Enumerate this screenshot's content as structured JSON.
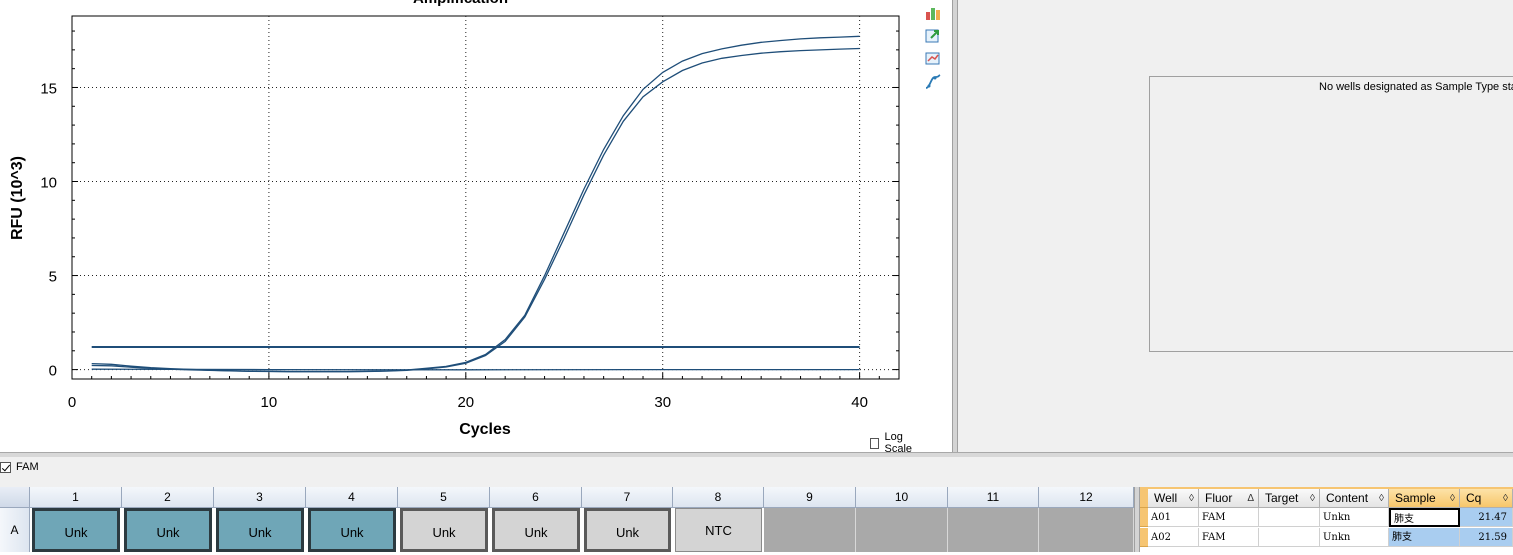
{
  "chart_data": {
    "type": "line",
    "title": "Amplification",
    "xlabel": "Cycles",
    "ylabel": "RFU (10^3)",
    "xlim": [
      0,
      42
    ],
    "ylim": [
      -0.5,
      18.8
    ],
    "xticks": [
      0,
      10,
      20,
      30,
      40
    ],
    "yticks": [
      0,
      5,
      10,
      15
    ],
    "grid": "dotted",
    "threshold": 1.2,
    "series": [
      {
        "well": "A01",
        "color": "#1f4e79",
        "x": [
          1,
          2,
          3,
          4,
          5,
          6,
          7,
          8,
          9,
          10,
          11,
          12,
          13,
          14,
          15,
          16,
          17,
          18,
          19,
          20,
          21,
          22,
          23,
          24,
          25,
          26,
          27,
          28,
          29,
          30,
          31,
          32,
          33,
          34,
          35,
          36,
          37,
          38,
          39,
          40
        ],
        "y": [
          0.32,
          0.28,
          0.18,
          0.1,
          0.05,
          0.01,
          -0.03,
          -0.06,
          -0.08,
          -0.09,
          -0.1,
          -0.1,
          -0.1,
          -0.1,
          -0.09,
          -0.07,
          -0.02,
          0.07,
          0.17,
          0.38,
          0.8,
          1.6,
          2.9,
          5.0,
          7.3,
          9.6,
          11.7,
          13.5,
          14.9,
          15.8,
          16.4,
          16.8,
          17.05,
          17.25,
          17.4,
          17.5,
          17.58,
          17.64,
          17.68,
          17.72
        ]
      },
      {
        "well": "A02",
        "color": "#1f4e79",
        "x": [
          1,
          2,
          3,
          4,
          5,
          6,
          7,
          8,
          9,
          10,
          11,
          12,
          13,
          14,
          15,
          16,
          17,
          18,
          19,
          20,
          21,
          22,
          23,
          24,
          25,
          26,
          27,
          28,
          29,
          30,
          31,
          32,
          33,
          34,
          35,
          36,
          37,
          38,
          39,
          40
        ],
        "y": [
          0.22,
          0.2,
          0.13,
          0.07,
          0.02,
          -0.01,
          -0.04,
          -0.07,
          -0.09,
          -0.1,
          -0.11,
          -0.11,
          -0.11,
          -0.11,
          -0.1,
          -0.08,
          -0.04,
          0.04,
          0.14,
          0.34,
          0.75,
          1.5,
          2.8,
          4.8,
          7.0,
          9.3,
          11.4,
          13.2,
          14.5,
          15.3,
          15.9,
          16.3,
          16.55,
          16.7,
          16.82,
          16.9,
          16.96,
          17.0,
          17.04,
          17.07
        ]
      },
      {
        "well": "A03",
        "color": "#1f4e79",
        "x": [
          1,
          10,
          20,
          30,
          40
        ],
        "y": [
          0.02,
          0.0,
          -0.01,
          0.0,
          0.0
        ]
      }
    ]
  },
  "toolbar": {
    "icons": [
      "copy-chart-icon",
      "export-icon",
      "chart-settings-icon",
      "curve-icon"
    ]
  },
  "standard_curve": {
    "message": "No wells designated as Sample Type standard."
  },
  "log_scale": {
    "label": "Log Scale",
    "checked": false
  },
  "fluor_filter": {
    "label": "FAM",
    "checked": true
  },
  "plate": {
    "columns": [
      "1",
      "2",
      "3",
      "4",
      "5",
      "6",
      "7",
      "8",
      "9",
      "10",
      "11",
      "12"
    ],
    "rows": [
      "A"
    ],
    "wells": [
      {
        "col": "1",
        "content": "Unk",
        "style": "unk-blue"
      },
      {
        "col": "2",
        "content": "Unk",
        "style": "unk-blue"
      },
      {
        "col": "3",
        "content": "Unk",
        "style": "unk-blue"
      },
      {
        "col": "4",
        "content": "Unk",
        "style": "unk-blue"
      },
      {
        "col": "5",
        "content": "Unk",
        "style": "unk-gray"
      },
      {
        "col": "6",
        "content": "Unk",
        "style": "unk-gray"
      },
      {
        "col": "7",
        "content": "Unk",
        "style": "unk-gray"
      },
      {
        "col": "8",
        "content": "NTC",
        "style": "ntc"
      },
      {
        "col": "9",
        "content": "",
        "style": "empty"
      },
      {
        "col": "10",
        "content": "",
        "style": "empty"
      },
      {
        "col": "11",
        "content": "",
        "style": "empty"
      },
      {
        "col": "12",
        "content": "",
        "style": "empty"
      }
    ]
  },
  "table": {
    "headers": [
      "Well",
      "Fluor",
      "Target",
      "Content",
      "Sample",
      "Cq"
    ],
    "sort_marks": [
      "◊",
      "Δ",
      "◊",
      "◊",
      "◊",
      "◊"
    ],
    "rows": [
      {
        "well": "A01",
        "fluor": "FAM",
        "target": "",
        "content": "Unkn",
        "sample": "肺支",
        "cq": "21.47"
      },
      {
        "well": "A02",
        "fluor": "FAM",
        "target": "",
        "content": "Unkn",
        "sample": "肺支",
        "cq": "21.59"
      }
    ]
  }
}
